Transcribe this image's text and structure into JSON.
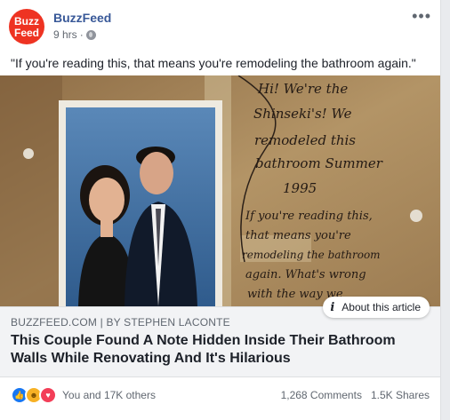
{
  "post": {
    "page_name": "BuzzFeed",
    "avatar_line1": "Buzz",
    "avatar_line2": "Feed",
    "time": "9 hrs",
    "separator": "·",
    "more_glyph": "•••",
    "caption": "\"If you're reading this, that means you're remodeling the bathroom again.\""
  },
  "photo": {
    "note_lines": [
      "Hi! We're the",
      "Shinseki's! We",
      "remodeled this",
      "bathroom Summer",
      "1995",
      "If you're reading this,",
      "that means you're",
      "remodeling the bathroom",
      "again. What's wrong",
      "with the way we"
    ]
  },
  "link": {
    "source": "BUZZFEED.COM | BY STEPHEN LACONTE",
    "title": "This Couple Found A Note Hidden Inside Their Bathroom Walls While Renovating And It's Hilarious",
    "about_label": "About this article"
  },
  "footer": {
    "reactions_text": "You and 17K others",
    "comments": "1,268 Comments",
    "shares": "1.5K Shares"
  }
}
